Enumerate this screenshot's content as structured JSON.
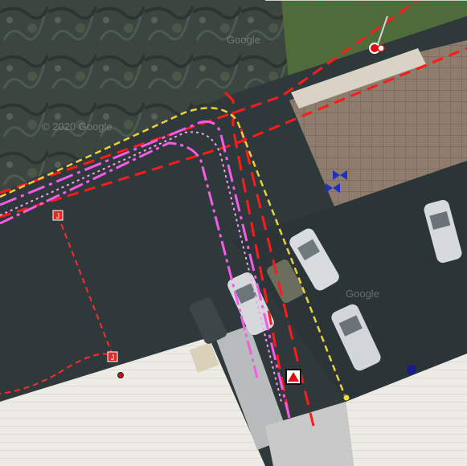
{
  "map": {
    "watermarks": [
      "© 2020 Google",
      "Google",
      "Google"
    ],
    "colors": {
      "boundary_red": "#ff1a1a",
      "utility_magenta": "#f25ce8",
      "utility_yellow": "#e8d23a",
      "road_asphalt": "#2f393b",
      "grass_dark": "#3c4a3c",
      "roof_white": "#f0f0ec",
      "paved_brown": "#8c7a6a"
    },
    "markers": [
      {
        "type": "junction-box",
        "label": "J",
        "color": "#e02a2a"
      },
      {
        "type": "junction-box",
        "label": "J",
        "color": "#e02a2a"
      },
      {
        "type": "warning-triangle",
        "color": "#e01010"
      },
      {
        "type": "valve",
        "color": "#2030c0"
      },
      {
        "type": "valve",
        "color": "#2030c0"
      },
      {
        "type": "hydrant",
        "color": "#e01010"
      },
      {
        "type": "node",
        "color": "#1a1a8a"
      },
      {
        "type": "node",
        "color": "#e8e040"
      },
      {
        "type": "node",
        "color": "#cc1010"
      }
    ]
  }
}
